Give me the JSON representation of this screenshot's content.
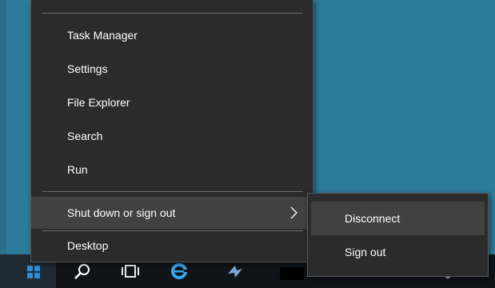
{
  "context_menu": {
    "items": [
      {
        "label": "Task Manager"
      },
      {
        "label": "Settings"
      },
      {
        "label": "File Explorer"
      },
      {
        "label": "Search"
      },
      {
        "label": "Run"
      },
      {
        "label": "Shut down or sign out",
        "has_submenu": true,
        "highlighted": true
      },
      {
        "label": "Desktop"
      }
    ]
  },
  "submenu": {
    "items": [
      {
        "label": "Disconnect",
        "highlighted": true
      },
      {
        "label": "Sign out"
      }
    ]
  },
  "colors": {
    "desktop_background": "#2d7b9a",
    "menu_background": "#2b2b2b",
    "menu_highlight": "#414141",
    "taskbar_background": "#101418",
    "start_logo": "#2b8fe0"
  },
  "taskbar": {
    "icons": [
      "windows-start-icon",
      "search-icon",
      "task-view-icon",
      "internet-explorer-icon",
      "app-icon",
      "app-window-icon",
      "system-tray-icon"
    ]
  }
}
